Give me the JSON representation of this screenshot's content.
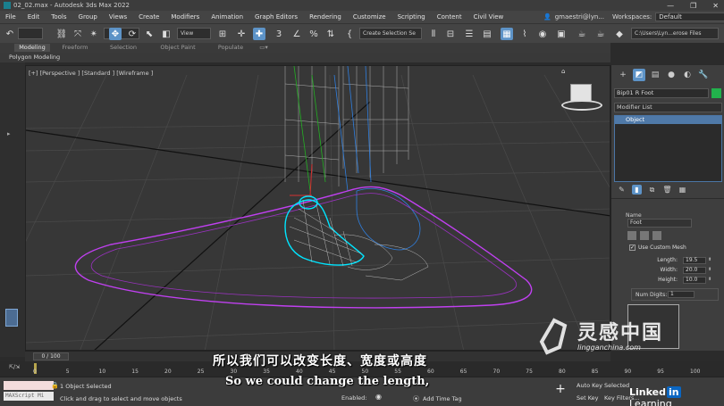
{
  "window": {
    "title": "02_02.max - Autodesk 3ds Max 2022",
    "controls": [
      "—",
      "❐",
      "✕"
    ]
  },
  "menu": [
    "File",
    "Edit",
    "Tools",
    "Group",
    "Views",
    "Create",
    "Modifiers",
    "Animation",
    "Graph Editors",
    "Rendering",
    "Customize",
    "Scripting",
    "Content",
    "Civil View"
  ],
  "user": {
    "name": "gmaestri@lyn..."
  },
  "workspaces": {
    "label": "Workspaces:",
    "value": "Default"
  },
  "toolbar": {
    "view_combo": "View",
    "selection_set": "Create Selection Se",
    "path": "C:\\Users\\Lyn...erose Files"
  },
  "ribbon": {
    "tabs": [
      "Modeling",
      "Freeform",
      "Selection",
      "Object Paint",
      "Populate"
    ],
    "active": "Modeling",
    "sub_label": "Polygon Modeling"
  },
  "viewport": {
    "label": "[+] [Perspective ] [Standard ] [Wireframe ]",
    "grid_color": "#4a4a4a",
    "selection_color": "#00e5ff",
    "spline_color": "#c040f0"
  },
  "command_panel": {
    "object_name": "Bip01 R Foot",
    "object_color": "#22b14c",
    "modifier_list": "Modifier List",
    "stack_items": [
      "Object"
    ],
    "name_label": "Name",
    "name_value": "Foot",
    "use_custom_mesh": "Use Custom Mesh",
    "params": [
      {
        "label": "Length:",
        "value": "19.5"
      },
      {
        "label": "Width:",
        "value": "20.0"
      },
      {
        "label": "Height:",
        "value": "10.0"
      }
    ],
    "num_digits_label": "Num Digits:",
    "num_digits_value": "1"
  },
  "timeline": {
    "frame": "0 / 100",
    "ticks": [
      "0",
      "5",
      "10",
      "15",
      "20",
      "25",
      "30",
      "35",
      "40",
      "45",
      "50",
      "55",
      "60",
      "65",
      "70",
      "75",
      "80",
      "85",
      "90",
      "95",
      "100"
    ]
  },
  "status": {
    "maxscript": "MAXScript Mi",
    "selected": "1 Object Selected",
    "hint": "Click and drag to select and move objects",
    "enabled": "Enabled:",
    "add_time_tag": "Add Time Tag",
    "auto_key": "Auto Key",
    "set_key": "Set Key",
    "selected_mode": "Selected",
    "key_filters": "Key Filters..."
  },
  "subtitles": {
    "cn": "所以我们可以改变长度、宽度或高度",
    "en": "So we could change the length,"
  },
  "watermark": {
    "cn": "灵感中国",
    "url": "lingganchina.com"
  },
  "branding": {
    "linkedin_a": "Linked",
    "linkedin_in": "in",
    "linkedin_b": " Learning"
  }
}
